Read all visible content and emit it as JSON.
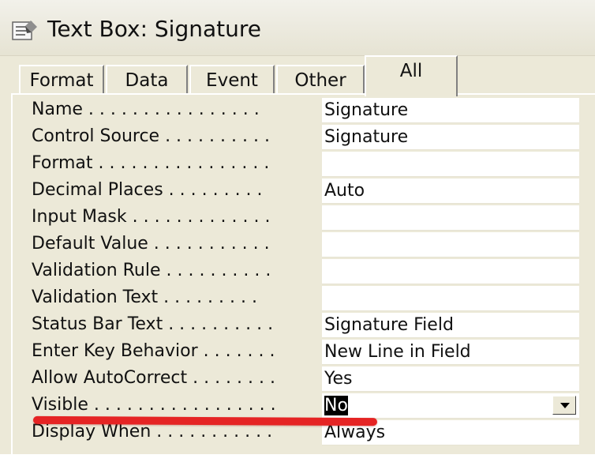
{
  "window": {
    "title": "Text Box: Signature",
    "icon": "properties-sheet-icon"
  },
  "tabs": [
    {
      "label": "Format"
    },
    {
      "label": "Data"
    },
    {
      "label": "Event"
    },
    {
      "label": "Other"
    },
    {
      "label": "All",
      "active": true
    }
  ],
  "properties": [
    {
      "label": "Name . . . . . . . . . . . . . . . .",
      "value": "Signature"
    },
    {
      "label": "Control Source . . . . . . . . . .",
      "value": "Signature"
    },
    {
      "label": "Format . . . . . . . . . . . . . . . .",
      "value": ""
    },
    {
      "label": "Decimal Places . . . . . . . . .",
      "value": "Auto"
    },
    {
      "label": "Input Mask . . . . . . . . . . . . .",
      "value": ""
    },
    {
      "label": "Default Value . . . . . . . . . . .",
      "value": ""
    },
    {
      "label": "Validation Rule . . . . . . . . . .",
      "value": ""
    },
    {
      "label": "Validation Text . . . . . . . . .",
      "value": ""
    },
    {
      "label": "Status Bar Text . . . . . . . . . .",
      "value": "Signature Field"
    },
    {
      "label": "Enter Key Behavior . . . . . . .",
      "value": "New Line in Field"
    },
    {
      "label": "Allow AutoCorrect . . . . . . . .",
      "value": "Yes"
    },
    {
      "label": "Visible . . . . . . . . . . . . . . . . .",
      "value": "No",
      "selected": true,
      "dropdown": true
    },
    {
      "label": "Display When . . . . . . . . . . .",
      "value": "Always"
    }
  ],
  "colors": {
    "highlight_stroke": "#e52424",
    "panel": "#ece9d8"
  }
}
